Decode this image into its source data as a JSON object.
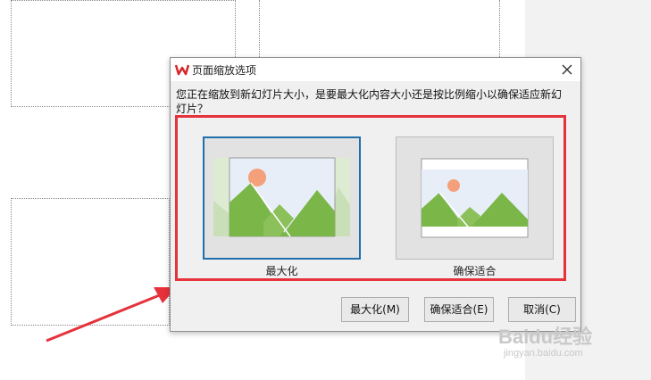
{
  "dialog": {
    "title": "页面缩放选项",
    "message": "您正在缩放到新幻灯片大小，是要最大化内容大小还是按比例缩小以确保适应新幻灯片？",
    "options": [
      {
        "label": "最大化",
        "selected": true
      },
      {
        "label": "确保适合",
        "selected": false
      }
    ],
    "buttons": {
      "maximize": "最大化(M)",
      "ensure_fit": "确保适合(E)",
      "cancel": "取消(C)"
    }
  },
  "watermark": {
    "logo": "Baidu经验",
    "url": "jingyan.baidu.com"
  },
  "colors": {
    "highlight": "#e5323b",
    "selection": "#1f6fab",
    "arrow": "#e5323b",
    "mountain": "#7ab648",
    "sun": "#f4a07a",
    "sky": "#e8eef8"
  }
}
